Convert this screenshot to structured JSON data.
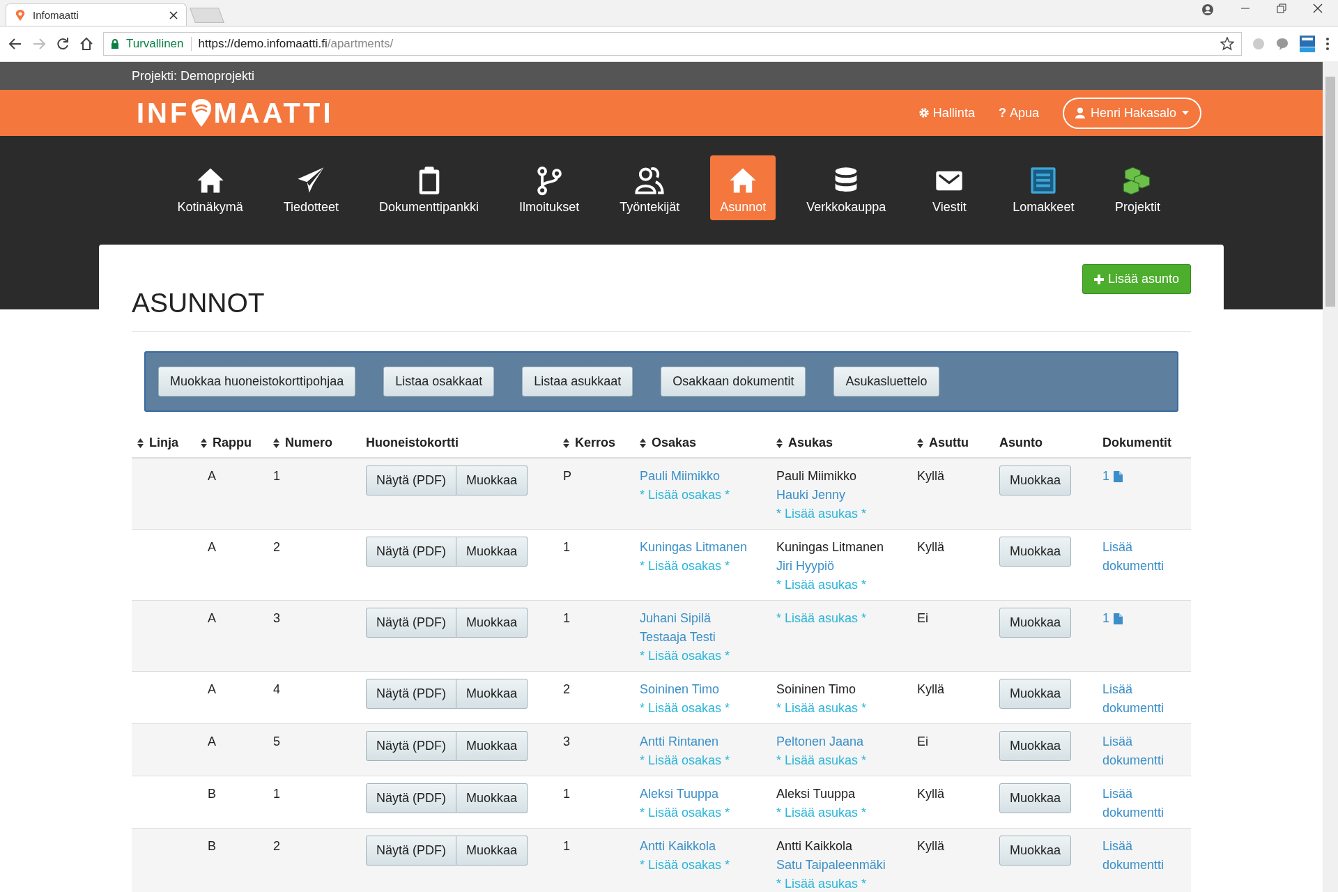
{
  "browser": {
    "tab_title": "Infomaatti",
    "secure_label": "Turvallinen",
    "url_host": "https://demo.infomaatti.fi",
    "url_path": "/apartments/"
  },
  "project_bar": {
    "label": "Projekti: Demoprojekti"
  },
  "header": {
    "logo_start": "INF",
    "logo_end": "MAATTI",
    "links": [
      {
        "kind": "gear",
        "label": "Hallinta"
      },
      {
        "kind": "question",
        "icon_text": "?",
        "label": "Apua"
      }
    ],
    "user": "Henri Hakasalo"
  },
  "nav": [
    {
      "kind": "home",
      "label": "Kotinäkymä",
      "selected": false
    },
    {
      "kind": "plane",
      "label": "Tiedotteet",
      "selected": false
    },
    {
      "kind": "clipboard",
      "label": "Dokumenttipankki",
      "selected": false
    },
    {
      "kind": "branch",
      "label": "Ilmoitukset",
      "selected": false
    },
    {
      "kind": "users",
      "label": "Työntekijät",
      "selected": false
    },
    {
      "kind": "home",
      "label": "Asunnot",
      "selected": true
    },
    {
      "kind": "database",
      "label": "Verkkokauppa",
      "selected": false
    },
    {
      "kind": "envelope",
      "label": "Viestit",
      "selected": false
    },
    {
      "kind": "list",
      "label": "Lomakkeet",
      "selected": false
    },
    {
      "kind": "cubes",
      "label": "Projektit",
      "selected": false
    }
  ],
  "page": {
    "title": "ASUNNOT",
    "add_button": "Lisää asunto"
  },
  "toolbar": [
    "Muokkaa huoneistokorttipohjaa",
    "Listaa osakkaat",
    "Listaa asukkaat",
    "Osakkaan dokumentit",
    "Asukasluettelo"
  ],
  "table": {
    "columns": [
      {
        "label": "Linja",
        "sortable": true
      },
      {
        "label": "Rappu",
        "sortable": true
      },
      {
        "label": "Numero",
        "sortable": true
      },
      {
        "label": "Huoneistokortti",
        "sortable": false
      },
      {
        "label": "Kerros",
        "sortable": true
      },
      {
        "label": "Osakas",
        "sortable": true
      },
      {
        "label": "Asukas",
        "sortable": true
      },
      {
        "label": "Asuttu",
        "sortable": true
      },
      {
        "label": "Asunto",
        "sortable": false
      },
      {
        "label": "Dokumentit",
        "sortable": false
      }
    ],
    "rows": [
      {
        "rappu": "A",
        "numero": "1",
        "card_buttons": [
          "Näytä (PDF)",
          "Muokkaa"
        ],
        "kerros": "P",
        "owners": [
          "Pauli Miimikko"
        ],
        "add_owner": "* Lisää osakas *",
        "residents": [
          {
            "name": "Pauli Miimikko",
            "kind": "text"
          },
          {
            "name": "Hauki Jenny",
            "kind": "link"
          }
        ],
        "add_resident": "* Lisää asukas *",
        "asuttu": "Kyllä",
        "edit": "Muokkaa",
        "documents": {
          "kind": "count",
          "text": "1"
        }
      },
      {
        "rappu": "A",
        "numero": "2",
        "card_buttons": [
          "Näytä (PDF)",
          "Muokkaa"
        ],
        "kerros": "1",
        "owners": [
          "Kuningas Litmanen"
        ],
        "add_owner": "* Lisää osakas *",
        "residents": [
          {
            "name": "Kuningas Litmanen",
            "kind": "text"
          },
          {
            "name": "Jiri Hyypiö",
            "kind": "link"
          }
        ],
        "add_resident": "* Lisää asukas *",
        "asuttu": "Kyllä",
        "edit": "Muokkaa",
        "documents": {
          "kind": "add",
          "text": "Lisää dokumentti"
        }
      },
      {
        "rappu": "A",
        "numero": "3",
        "card_buttons": [
          "Näytä (PDF)",
          "Muokkaa"
        ],
        "kerros": "1",
        "owners": [
          "Juhani Sipilä",
          "Testaaja Testi"
        ],
        "add_owner": "* Lisää osakas *",
        "residents": [],
        "add_resident": "* Lisää asukas *",
        "asuttu": "Ei",
        "edit": "Muokkaa",
        "documents": {
          "kind": "count",
          "text": "1"
        }
      },
      {
        "rappu": "A",
        "numero": "4",
        "card_buttons": [
          "Näytä (PDF)",
          "Muokkaa"
        ],
        "kerros": "2",
        "owners": [
          "Soininen Timo"
        ],
        "add_owner": "* Lisää osakas *",
        "residents": [
          {
            "name": "Soininen Timo",
            "kind": "text"
          }
        ],
        "add_resident": "* Lisää asukas *",
        "asuttu": "Kyllä",
        "edit": "Muokkaa",
        "documents": {
          "kind": "add",
          "text": "Lisää dokumentti"
        }
      },
      {
        "rappu": "A",
        "numero": "5",
        "card_buttons": [
          "Näytä (PDF)",
          "Muokkaa"
        ],
        "kerros": "3",
        "owners": [
          "Antti Rintanen"
        ],
        "add_owner": "* Lisää osakas *",
        "residents": [
          {
            "name": "Peltonen Jaana",
            "kind": "link"
          }
        ],
        "add_resident": "* Lisää asukas *",
        "asuttu": "Ei",
        "edit": "Muokkaa",
        "documents": {
          "kind": "add",
          "text": "Lisää dokumentti"
        }
      },
      {
        "rappu": "B",
        "numero": "1",
        "card_buttons": [
          "Näytä (PDF)",
          "Muokkaa"
        ],
        "kerros": "1",
        "owners": [
          "Aleksi Tuuppa"
        ],
        "add_owner": "* Lisää osakas *",
        "residents": [
          {
            "name": "Aleksi Tuuppa",
            "kind": "text"
          }
        ],
        "add_resident": "* Lisää asukas *",
        "asuttu": "Kyllä",
        "edit": "Muokkaa",
        "documents": {
          "kind": "add",
          "text": "Lisää dokumentti"
        }
      },
      {
        "rappu": "B",
        "numero": "2",
        "card_buttons": [
          "Näytä (PDF)",
          "Muokkaa"
        ],
        "kerros": "1",
        "owners": [
          "Antti Kaikkola"
        ],
        "add_owner": "* Lisää osakas *",
        "residents": [
          {
            "name": "Antti Kaikkola",
            "kind": "text"
          },
          {
            "name": "Satu Taipaleenmäki",
            "kind": "link"
          }
        ],
        "add_resident": "* Lisää asukas *",
        "asuttu": "Kyllä",
        "edit": "Muokkaa",
        "documents": {
          "kind": "add",
          "text": "Lisää dokumentti"
        }
      }
    ]
  }
}
